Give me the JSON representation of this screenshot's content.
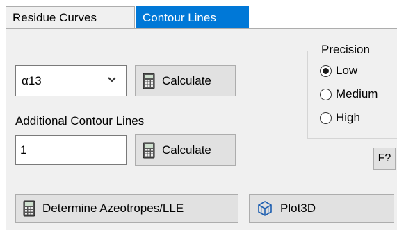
{
  "tabs": [
    {
      "label": "Residue Curves",
      "active": false
    },
    {
      "label": "Contour Lines",
      "active": true
    }
  ],
  "contour_select": {
    "value": "α13"
  },
  "calculate_label": "Calculate",
  "additional_label": "Additional Contour Lines",
  "additional_input": {
    "value": "1"
  },
  "precision": {
    "title": "Precision",
    "options": [
      {
        "label": "Low",
        "selected": true
      },
      {
        "label": "Medium",
        "selected": false
      },
      {
        "label": "High",
        "selected": false
      }
    ]
  },
  "help_button_label": "F?",
  "determine_label": "Determine Azeotropes/LLE",
  "plot3d_label": "Plot3D",
  "colors": {
    "active_tab": "#0078d7",
    "panel": "#f0f0f0",
    "button": "#e1e1e1"
  },
  "icons": {
    "calculate": "calculator-icon",
    "determine": "calculator-icon",
    "plot3d": "cube-icon",
    "select": "chevron-down-icon"
  }
}
